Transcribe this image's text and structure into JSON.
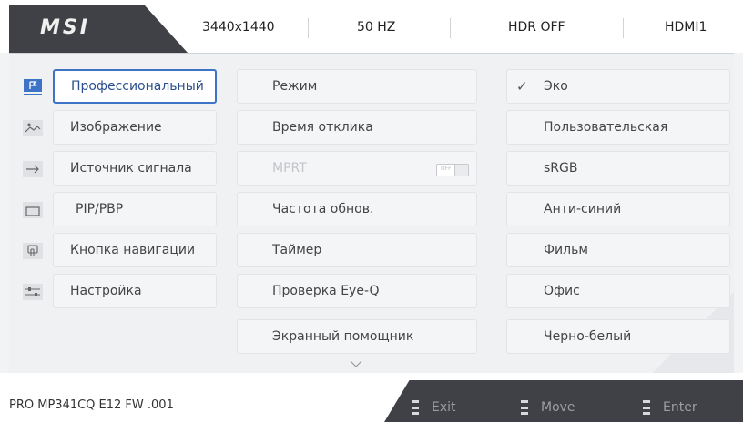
{
  "header": {
    "brand": "MSI",
    "resolution": "3440x1440",
    "refresh": "50 HZ",
    "hdr": "HDR OFF",
    "input": "HDMI1"
  },
  "sidebar": {
    "items": [
      {
        "label": "Профессиональный",
        "icon": "flag-icon",
        "active": true
      },
      {
        "label": "Изображение",
        "icon": "image-icon"
      },
      {
        "label": "Источник сигнала",
        "icon": "arrow-right-icon"
      },
      {
        "label": "PIP/PBP",
        "icon": "window-icon"
      },
      {
        "label": "Кнопка навигации",
        "icon": "navigation-key-icon"
      },
      {
        "label": "Настройка",
        "icon": "sliders-icon"
      }
    ]
  },
  "submenu": {
    "items": [
      {
        "label": "Режим"
      },
      {
        "label": "Время отклика"
      },
      {
        "label": "MPRT",
        "disabled": true,
        "toggle": "OFF"
      },
      {
        "label": "Частота обнов."
      },
      {
        "label": "Таймер"
      },
      {
        "label": "Проверка Eye-Q"
      },
      {
        "label": "Экранный помощник"
      }
    ],
    "more_icon": "chevron-down-icon"
  },
  "options": {
    "items": [
      {
        "label": "Эко",
        "selected": true
      },
      {
        "label": "Пользовательская"
      },
      {
        "label": "sRGB"
      },
      {
        "label": "Анти-синий"
      },
      {
        "label": "Фильм"
      },
      {
        "label": "Офис"
      },
      {
        "label": "Черно-белый"
      }
    ]
  },
  "footer": {
    "model": "PRO MP341CQ E12  FW .001",
    "buttons": [
      {
        "label": "Exit",
        "icon": "button-icon"
      },
      {
        "label": "Move",
        "icon": "button-icon"
      },
      {
        "label": "Enter",
        "icon": "button-icon"
      }
    ]
  },
  "colors": {
    "accent": "#3e74c8",
    "dark_bar": "#3f4146",
    "panel_bg": "#f0f1f3"
  }
}
